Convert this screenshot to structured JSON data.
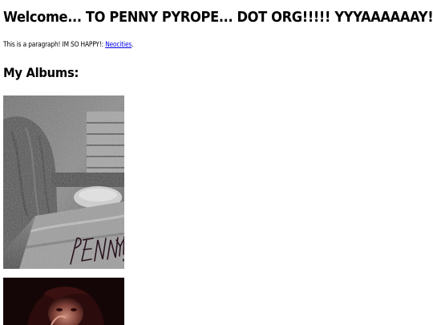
{
  "header": {
    "title": "Welcome... TO PENNY PYROPE... DOT ORG!!!!! YYYAAAAAAY!!!"
  },
  "intro": {
    "text": "This is a paragraph! IM SO HAPPY!:",
    "link_label": "Neocities",
    "trailing": "."
  },
  "albums": {
    "heading": "My Albums:",
    "items": [
      {
        "icon": "album-cover-bedroom-image",
        "signature": "PENNY!"
      },
      {
        "icon": "album-cover-portrait-image"
      }
    ]
  }
}
